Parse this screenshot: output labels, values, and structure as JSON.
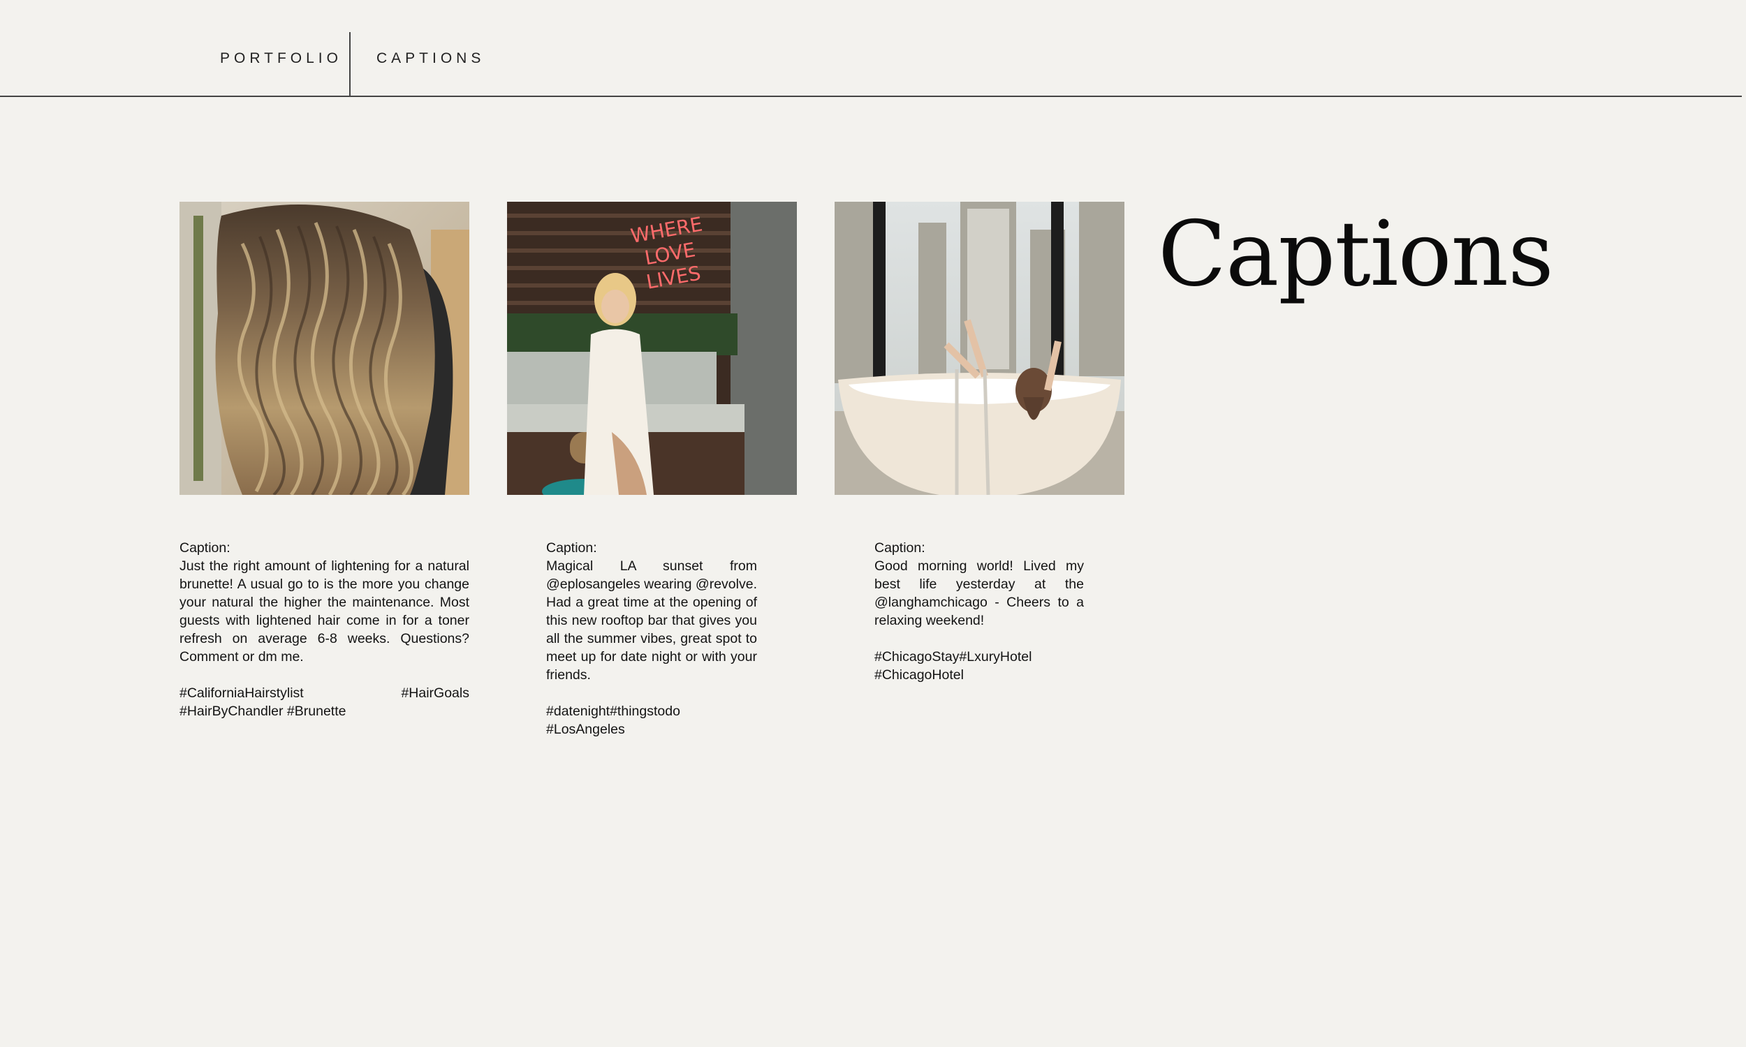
{
  "nav": {
    "items": [
      {
        "label": "PORTFOLIO"
      },
      {
        "label": "CAPTIONS"
      }
    ]
  },
  "title": "Captions",
  "posts": [
    {
      "image": "long wavy balayage hair photo",
      "caption_label": "Caption:",
      "caption": "Just the right amount of lightening for a natural brunette! A usual go to is the more you change your natural the higher the maintenance. Most guests with lightened hair come in for a toner refresh on average 6-8 weeks. Questions? Comment or dm me.",
      "tags": "#CaliforniaHairstylist #HairGoals #HairByChandler #Brunette"
    },
    {
      "image": "woman in white dress under neon sign",
      "neon_text": [
        "WHERE",
        "LOVE",
        "LIVES"
      ],
      "caption_label": "Caption:",
      "caption": "Magical LA sunset from @eplosangeles wearing @revolve. Had a great time at the opening of this new rooftop bar that gives you all the summer vibes, great spot to meet up for date night or with your friends.",
      "tags": "#datenight#thingstodo #LosAngeles"
    },
    {
      "image": "woman in bathtub with city view",
      "caption_label": "Caption:",
      "caption": "Good morning world! Lived my best life yesterday at the @langhamchicago - Cheers to a relaxing weekend!",
      "tags": "#ChicagoStay#LxuryHotel #ChicagoHotel"
    }
  ],
  "colors": {
    "background": "#f3f2ee",
    "text": "#111111",
    "rule": "#444444"
  }
}
